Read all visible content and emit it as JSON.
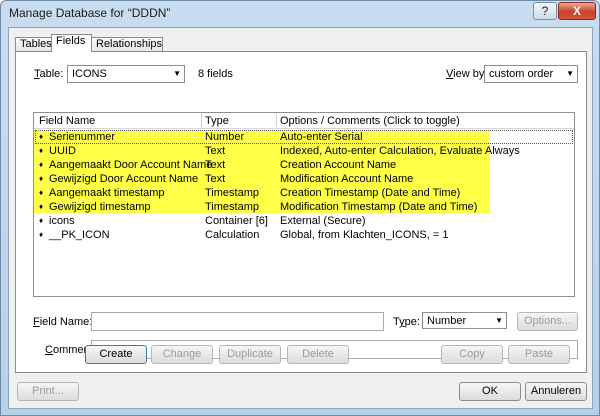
{
  "window": {
    "title": "Manage Database for “DDDN”",
    "help_label": "?",
    "close_label": "X"
  },
  "tabs": [
    {
      "label": "Tables",
      "active": false
    },
    {
      "label": "Fields",
      "active": true
    },
    {
      "label": "Relationships",
      "active": false
    }
  ],
  "table_selector": {
    "label": "Table:",
    "value": "ICONS",
    "field_count": "8 fields"
  },
  "view_by": {
    "label": "View by:",
    "value": "custom order"
  },
  "columns": {
    "name": "Field Name",
    "type": "Type",
    "options": "Options / Comments   (Click to toggle)"
  },
  "fields": [
    {
      "name": "Serienummer",
      "type": "Number",
      "options": "Auto-enter Serial",
      "highlighted": true
    },
    {
      "name": "UUID",
      "type": "Text",
      "options": "Indexed, Auto-enter Calculation, Evaluate Always",
      "highlighted": true
    },
    {
      "name": "Aangemaakt Door Account Name",
      "type": "Text",
      "options": "Creation Account Name",
      "highlighted": true
    },
    {
      "name": "Gewijzigd Door Account Name",
      "type": "Text",
      "options": "Modification Account Name",
      "highlighted": true
    },
    {
      "name": "Aangemaakt timestamp",
      "type": "Timestamp",
      "options": "Creation Timestamp (Date and Time)",
      "highlighted": true
    },
    {
      "name": "Gewijzigd timestamp",
      "type": "Timestamp",
      "options": "Modification Timestamp (Date and Time)",
      "highlighted": true
    },
    {
      "name": "icons",
      "type": "Container [6]",
      "options": "External (Secure)",
      "highlighted": false
    },
    {
      "name": "__PK_ICON",
      "type": "Calculation",
      "options": "Global, from Klachten_ICONS, = 1",
      "highlighted": false
    }
  ],
  "field_name": {
    "label": "Field Name:",
    "value": ""
  },
  "type_select": {
    "label": "Type:",
    "value": "Number"
  },
  "comment": {
    "label": "Comment:",
    "value": ""
  },
  "buttons": {
    "options": "Options...",
    "create": "Create",
    "change": "Change",
    "duplicate": "Duplicate",
    "delete": "Delete",
    "copy": "Copy",
    "paste": "Paste",
    "print": "Print...",
    "ok": "OK",
    "cancel": "Annuleren"
  },
  "colors": {
    "highlight": "#ffff47",
    "selection_outline": "#555555"
  }
}
